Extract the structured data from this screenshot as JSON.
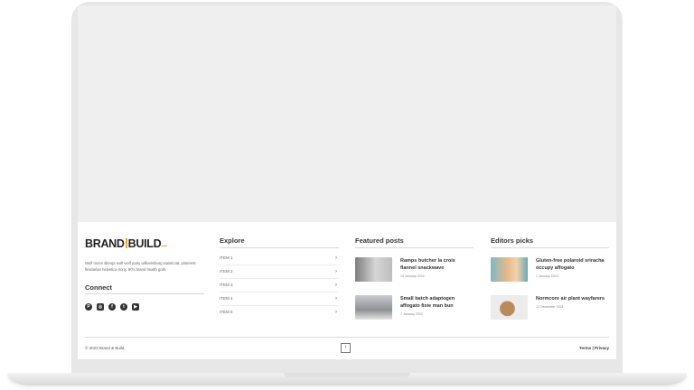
{
  "footer": {
    "brand": {
      "part1": "BRAND",
      "part2": "BUILD"
    },
    "about": "Wolf moon disrupt wolf wolf party williamsburg waistcoat, pinterest flexitarian helvetica irony. 90's brand health goth.",
    "connect_title": "Connect",
    "socials": [
      {
        "icon": "pinterest-icon",
        "glyph": "P"
      },
      {
        "icon": "instagram-icon",
        "glyph": "◎"
      },
      {
        "icon": "facebook-icon",
        "glyph": "f"
      },
      {
        "icon": "twitter-icon",
        "glyph": "t"
      },
      {
        "icon": "youtube-icon",
        "glyph": "▶"
      }
    ],
    "explore": {
      "title": "Explore",
      "items": [
        "ITEM 1",
        "ITEM 2",
        "ITEM 3",
        "ITEM 4",
        "ITEM 5"
      ]
    },
    "featured": {
      "title": "Featured posts",
      "posts": [
        {
          "title": "Ramps butcher la croix flannel snackwave",
          "date": "14 January 2022",
          "thumb_color": "#9a9a9a"
        },
        {
          "title": "Small batch adaptogen affogato fixie man bun",
          "date": "7 January 2022",
          "thumb_color": "#8e9094"
        }
      ]
    },
    "editors": {
      "title": "Editors picks",
      "posts": [
        {
          "title": "Gluten-free polaroid sriracha occupy affogato",
          "date": "1 January 2022",
          "thumb_color": "#e8b98a"
        },
        {
          "title": "Normcore air plant wayfarers",
          "date": "12 December 2021",
          "thumb_color": "#c9a27a"
        }
      ]
    },
    "copyright": "© 2023 Brand & Build.",
    "to_top": "↑",
    "legal": "Terms | Privacy"
  },
  "colors": {
    "accent": "#e5a52b",
    "screen_bg": "#efefef",
    "device_bg": "#e7e7e7"
  }
}
